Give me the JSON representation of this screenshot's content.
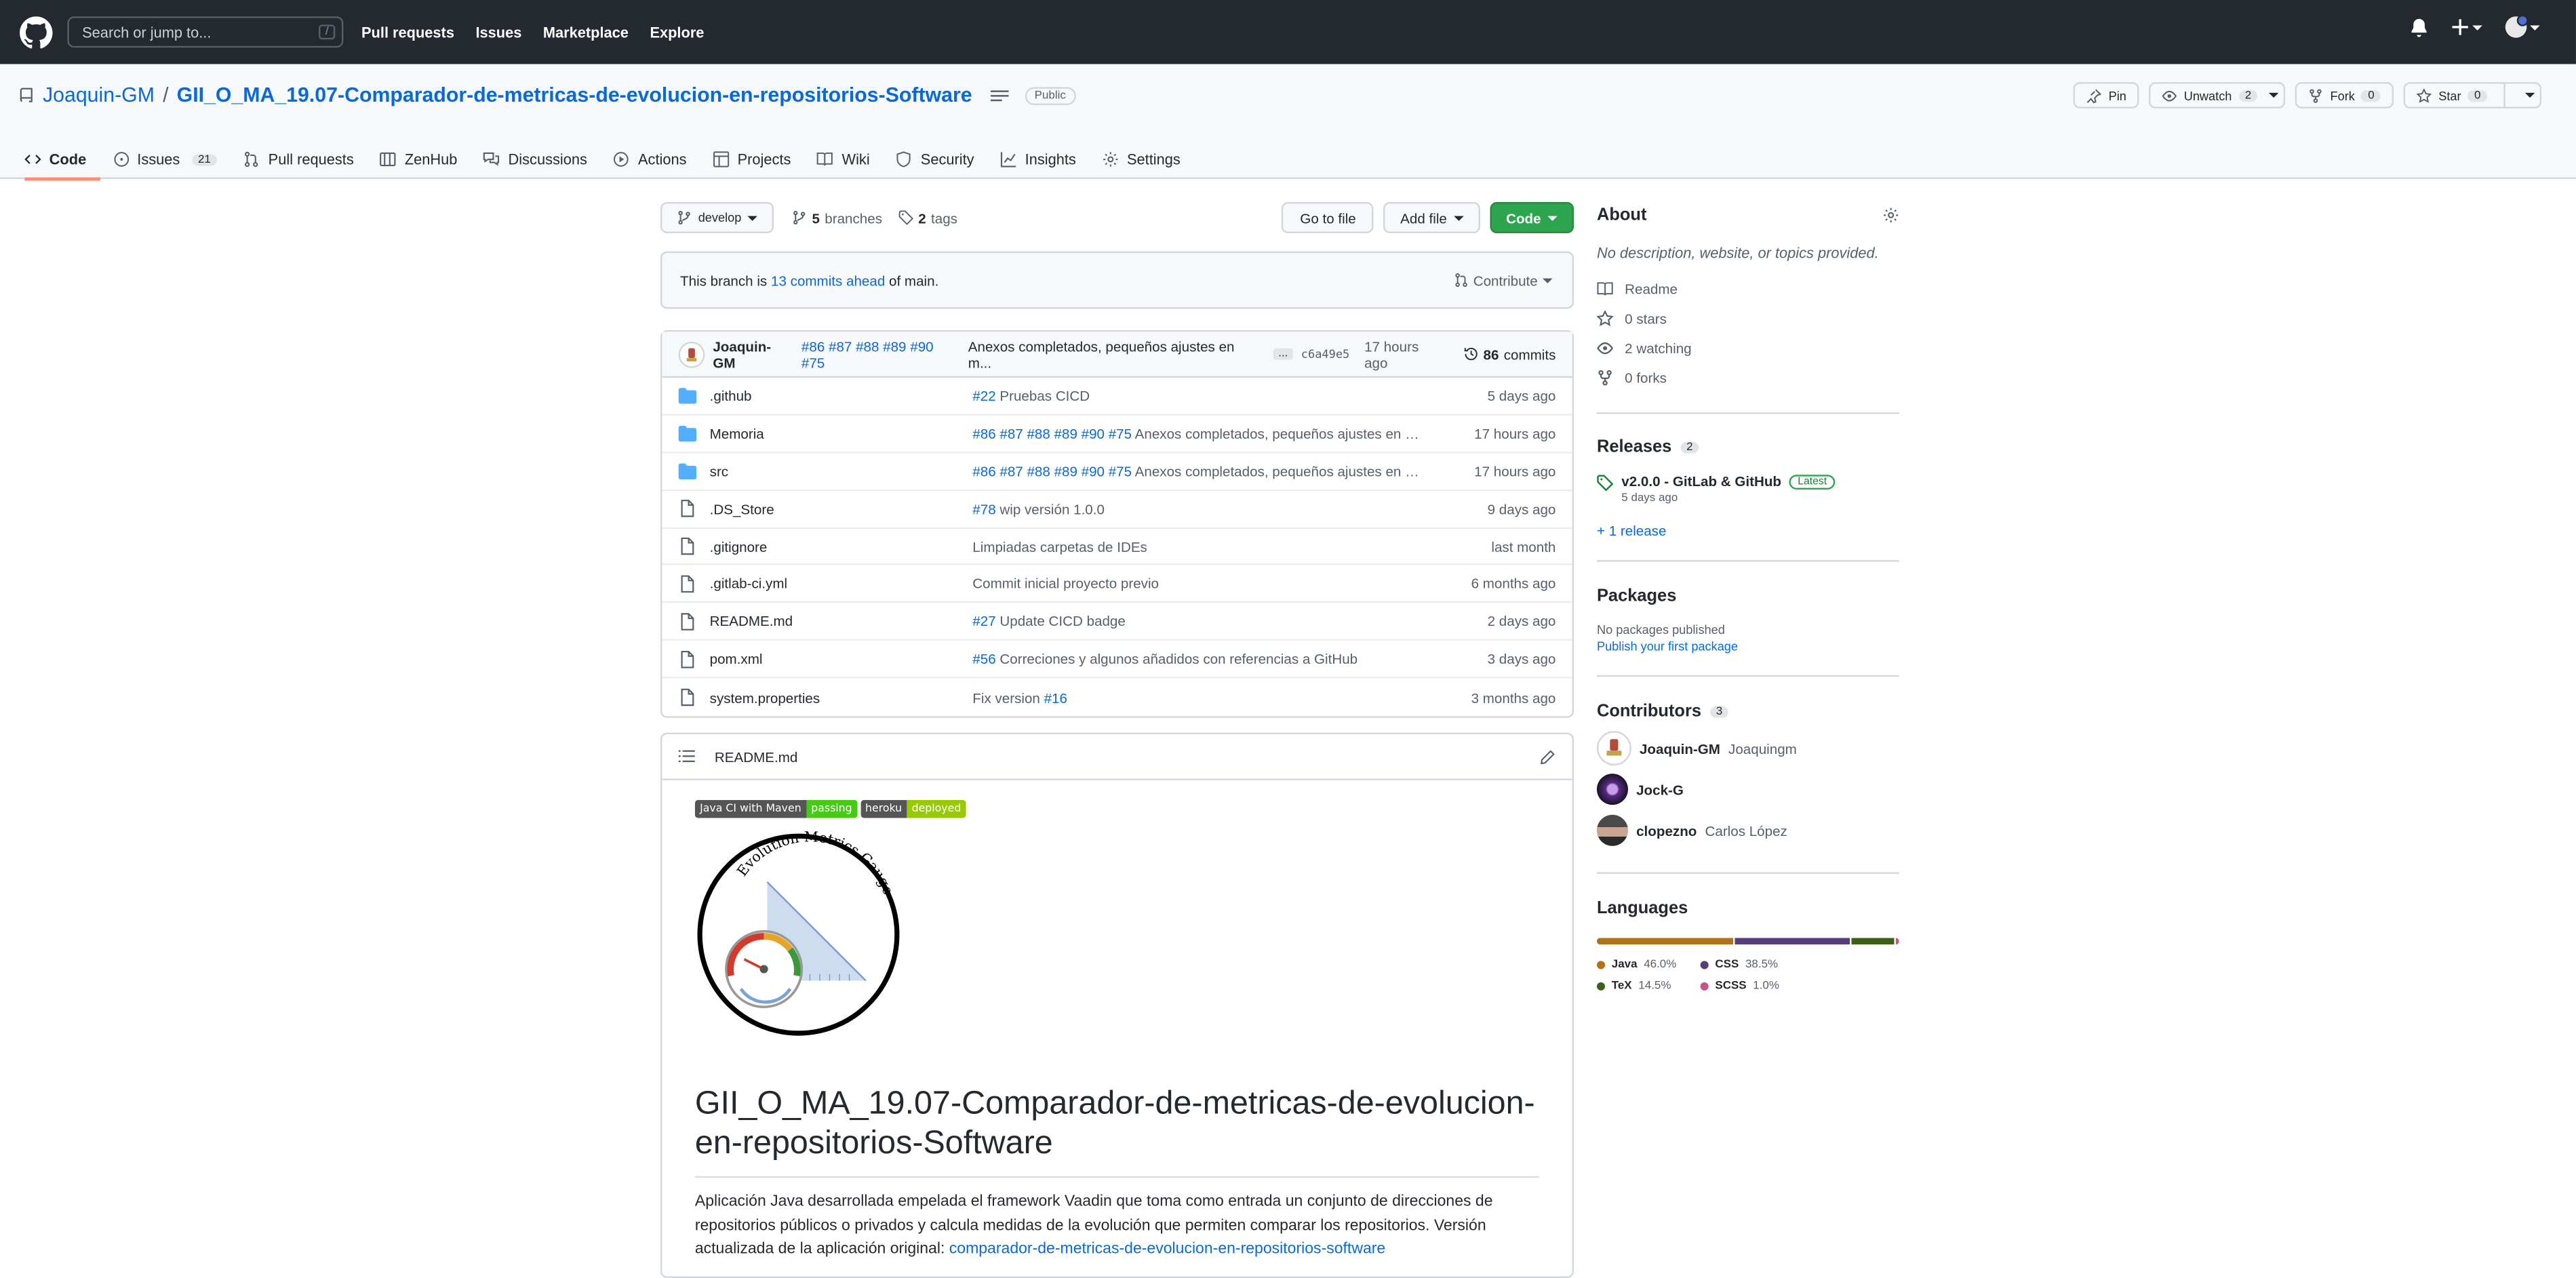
{
  "topbar": {
    "search_placeholder": "Search or jump to...",
    "search_shortcut": "/",
    "nav": [
      "Pull requests",
      "Issues",
      "Marketplace",
      "Explore"
    ]
  },
  "repo": {
    "owner": "Joaquin-GM",
    "separator": "/",
    "name": "GII_O_MA_19.07-Comparador-de-metricas-de-evolucion-en-repositorios-Software",
    "visibility": "Public",
    "actions": {
      "pin": "Pin",
      "unwatch": "Unwatch",
      "unwatch_count": "2",
      "fork": "Fork",
      "fork_count": "0",
      "star": "Star",
      "star_count": "0"
    },
    "tabs": [
      {
        "label": "Code",
        "icon": "code-icon"
      },
      {
        "label": "Issues",
        "icon": "issue-icon",
        "count": "21"
      },
      {
        "label": "Pull requests",
        "icon": "pull-request-icon"
      },
      {
        "label": "ZenHub",
        "icon": "zenhub-icon"
      },
      {
        "label": "Discussions",
        "icon": "discussion-icon"
      },
      {
        "label": "Actions",
        "icon": "play-icon"
      },
      {
        "label": "Projects",
        "icon": "project-icon"
      },
      {
        "label": "Wiki",
        "icon": "book-icon"
      },
      {
        "label": "Security",
        "icon": "shield-icon"
      },
      {
        "label": "Insights",
        "icon": "graph-icon"
      },
      {
        "label": "Settings",
        "icon": "gear-icon"
      }
    ]
  },
  "toolbar": {
    "branch": "develop",
    "branches_count": "5",
    "branches_label": "branches",
    "tags_count": "2",
    "tags_label": "tags",
    "go_to_file": "Go to file",
    "add_file": "Add file",
    "code": "Code"
  },
  "ahead": {
    "prefix": "This branch is",
    "link": "13 commits ahead",
    "suffix": "of main.",
    "contribute": "Contribute"
  },
  "latest_commit": {
    "author": "Joaquin-GM",
    "refs": "#86 #87 #88 #89 #90 #75",
    "message": "Anexos completados, pequeños ajustes en m...",
    "ellipsis": "...",
    "sha": "c6a49e5",
    "time": "17 hours ago",
    "commits_count": "86",
    "commits_label": "commits"
  },
  "files": [
    {
      "type": "dir",
      "name": ".github",
      "ref": "#22",
      "msg": "Pruebas CICD",
      "age": "5 days ago"
    },
    {
      "type": "dir",
      "name": "Memoria",
      "ref": "#86 #87 #88 #89 #90 #75",
      "msg": "Anexos completados, pequeños ajustes en m...",
      "age": "17 hours ago"
    },
    {
      "type": "dir",
      "name": "src",
      "ref": "#86 #87 #88 #89 #90 #75",
      "msg": "Anexos completados, pequeños ajustes en m...",
      "age": "17 hours ago"
    },
    {
      "type": "file",
      "name": ".DS_Store",
      "ref": "#78",
      "msg": "wip versión 1.0.0",
      "age": "9 days ago"
    },
    {
      "type": "file",
      "name": ".gitignore",
      "ref": "",
      "msg": "Limpiadas carpetas de IDEs",
      "age": "last month"
    },
    {
      "type": "file",
      "name": ".gitlab-ci.yml",
      "ref": "",
      "msg": "Commit inicial proyecto previo",
      "age": "6 months ago"
    },
    {
      "type": "file",
      "name": "README.md",
      "ref": "#27",
      "msg": "Update CICD badge",
      "age": "2 days ago"
    },
    {
      "type": "file",
      "name": "pom.xml",
      "ref": "#56",
      "msg": "Correciones y algunos añadidos con referencias a GitHub",
      "age": "3 days ago"
    },
    {
      "type": "file",
      "name": "system.properties",
      "ref": "",
      "msg": "Fix version",
      "msg_ref": "#16",
      "age": "3 months ago"
    }
  ],
  "readme": {
    "filename": "README.md",
    "badge1_left": "Java CI with Maven",
    "badge1_right": "passing",
    "badge2_left": "heroku",
    "badge2_right": "deployed",
    "logo_text": "Evolution Metrics Gauge",
    "title": "GII_O_MA_19.07-Comparador-de-metricas-de-evolucion-en-repositorios-Software",
    "description": "Aplicación Java desarrollada empelada el framework Vaadin que toma como entrada un conjunto de direcciones de repositorios públicos o privados y calcula medidas de la evolución que permiten comparar los repositorios. Versión actualizada de la aplicación original:",
    "description_link": "comparador-de-metricas-de-evolucion-en-repositorios-software"
  },
  "sidebar": {
    "about_title": "About",
    "about_desc": "No description, website, or topics provided.",
    "about_items": [
      {
        "icon": "book-icon",
        "label": "Readme"
      },
      {
        "icon": "star-icon",
        "label": "0 stars"
      },
      {
        "icon": "eye-icon",
        "label": "2 watching"
      },
      {
        "icon": "fork-icon",
        "label": "0 forks"
      }
    ],
    "releases_title": "Releases",
    "releases_count": "2",
    "release_name": "v2.0.0 - GitLab & GitHub",
    "release_badge": "Latest",
    "release_date": "5 days ago",
    "more_releases": "+ 1 release",
    "packages_title": "Packages",
    "packages_none": "No packages published",
    "packages_link": "Publish your first package",
    "contributors_title": "Contributors",
    "contributors_count": "3",
    "contributors": [
      {
        "login": "Joaquin-GM",
        "name": "Joaquingm"
      },
      {
        "login": "Jock-G",
        "name": ""
      },
      {
        "login": "clopezno",
        "name": "Carlos López"
      }
    ],
    "languages_title": "Languages",
    "languages": [
      {
        "name": "Java",
        "pct": "46.0%",
        "value": 46.0,
        "color": "#b07219"
      },
      {
        "name": "CSS",
        "pct": "38.5%",
        "value": 38.5,
        "color": "#563d7c"
      },
      {
        "name": "TeX",
        "pct": "14.5%",
        "value": 14.5,
        "color": "#3d6117"
      },
      {
        "name": "SCSS",
        "pct": "1.0%",
        "value": 1.0,
        "color": "#c6538c"
      }
    ]
  }
}
